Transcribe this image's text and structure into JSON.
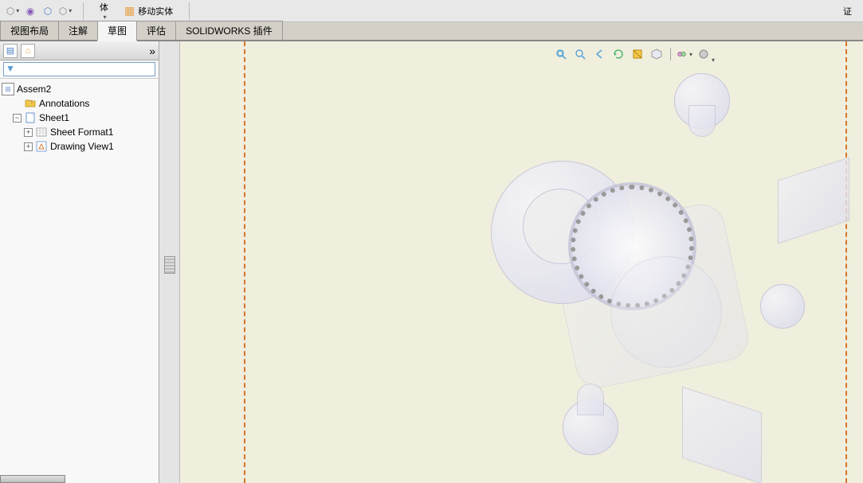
{
  "ribbon": {
    "items": [
      {
        "label": "",
        "icon": "hex-outline"
      },
      {
        "label": "",
        "icon": "hex-purple"
      },
      {
        "label": "",
        "icon": "hex-blue"
      },
      {
        "label": "",
        "icon": "dropdown"
      }
    ],
    "groups": [
      {
        "label": "体"
      },
      {
        "label": "移动实体",
        "icon": "grid-icon"
      }
    ],
    "right_items": [
      {
        "label": ""
      },
      {
        "label": "证"
      }
    ]
  },
  "tabs": [
    {
      "label": "视图布局",
      "active": false
    },
    {
      "label": "注解",
      "active": false
    },
    {
      "label": "草图",
      "active": true
    },
    {
      "label": "评估",
      "active": false
    },
    {
      "label": "SOLIDWORKS 插件",
      "active": false
    }
  ],
  "panel": {
    "filter_placeholder": ""
  },
  "tree": {
    "root": "Assem2",
    "nodes": [
      {
        "label": "Annotations",
        "icon": "folder",
        "level": 1,
        "expandable": false
      },
      {
        "label": "Sheet1",
        "icon": "sheet",
        "level": 1,
        "expandable": true,
        "expanded": true
      },
      {
        "label": "Sheet Format1",
        "icon": "format",
        "level": 2,
        "expandable": true
      },
      {
        "label": "Drawing View1",
        "icon": "view",
        "level": 2,
        "expandable": true
      }
    ]
  },
  "view_toolbar": {
    "icons": [
      "zoom-fit",
      "zoom-window",
      "prev-view",
      "spin",
      "section",
      "display-style",
      "hide-show",
      "appearance"
    ]
  }
}
